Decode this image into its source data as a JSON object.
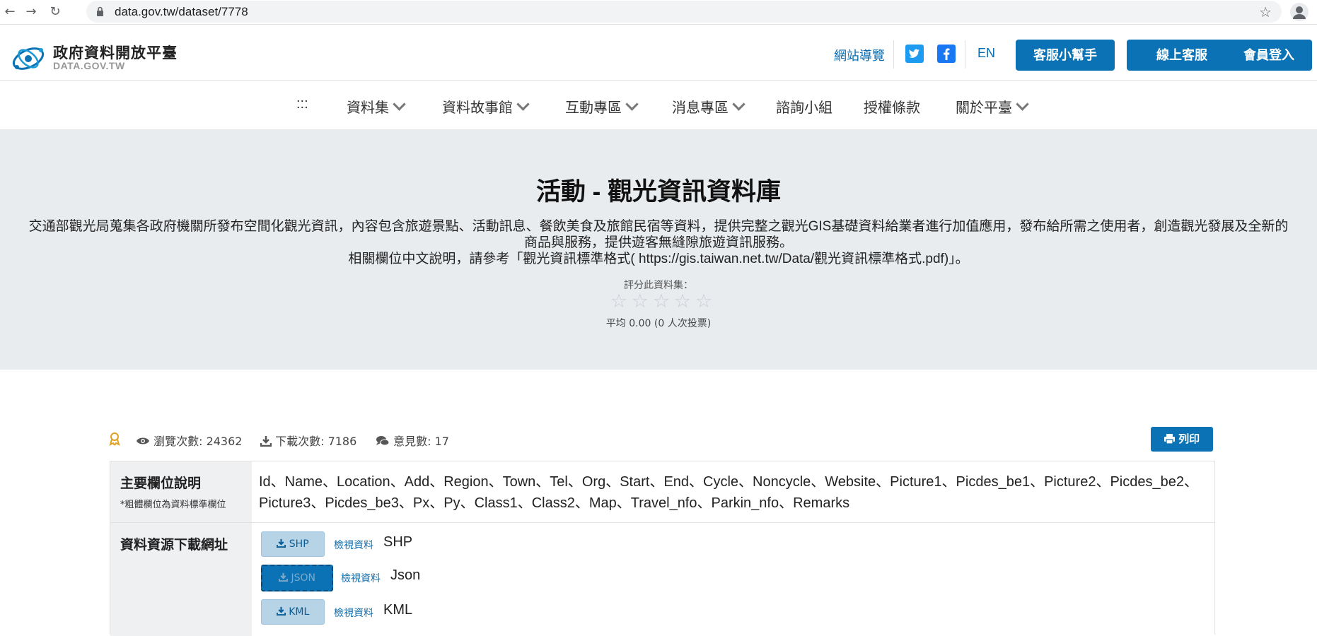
{
  "browser": {
    "url": "data.gov.tw/dataset/7778"
  },
  "header": {
    "logo_cn": "政府資料開放平臺",
    "logo_en": "DATA.GOV.TW",
    "site_guide": "網站導覽",
    "lang": "EN",
    "help_button": "客服小幫手",
    "online_service_button": "線上客服",
    "login_button": "會員登入"
  },
  "nav": {
    "accesskey": ":::",
    "items": [
      {
        "label": "資料集"
      },
      {
        "label": "資料故事館"
      },
      {
        "label": "互動專區"
      },
      {
        "label": "消息專區"
      },
      {
        "label": "諮詢小組"
      },
      {
        "label": "授權條款"
      },
      {
        "label": "關於平臺"
      }
    ]
  },
  "hero": {
    "title": "活動 - 觀光資訊資料庫",
    "desc_line1": "交通部觀光局蒐集各政府機關所發布空間化觀光資訊，內容包含旅遊景點、活動訊息、餐飲美食及旅館民宿等資料，提供完整之觀光GIS基礎資料給業者進行加值應用，發布給所需之使用者，創造觀光發展及全新的",
    "desc_line2": "商品與服務，提供遊客無縫隙旅遊資訊服務。",
    "desc_line3": "相關欄位中文說明，請參考「觀光資訊標準格式( https://gis.taiwan.net.tw/Data/觀光資訊標準格式.pdf)」。",
    "rate_label": "評分此資料集：",
    "rating": 0,
    "rating_max": 5,
    "rate_avg": "平均 0.00 (0 人次投票)"
  },
  "stats": {
    "views": "瀏覽次數: 24362",
    "downloads": "下載次數: 7186",
    "comments": "意見數: 17",
    "print_button": "列印"
  },
  "table": {
    "fields_title": "主要欄位說明",
    "fields_note": "*粗體欄位為資料標準欄位",
    "fields_line1": "Id、Name、Location、Add、Region、Town、Tel、Org、Start、End、Cycle、Noncycle、Website、Picture1、Picdes_be1、Picture2、Picdes_be2、",
    "fields_line2": "Picture3、Picdes_be3、Px、Py、Class1、Class2、Map、Travel_nfo、Parkin_nfo、Remarks",
    "download_title": "資料資源下載網址",
    "resources": [
      {
        "button": "SHP",
        "view": "檢視資料",
        "format": "SHP"
      },
      {
        "button": "JSON",
        "view": "檢視資料",
        "format": "Json"
      },
      {
        "button": "KML",
        "view": "檢視資料",
        "format": "KML"
      }
    ]
  },
  "colors": {
    "brand_blue": "#0a72b5",
    "hero_bg": "#e9ecef",
    "link": "#0a6cae"
  }
}
